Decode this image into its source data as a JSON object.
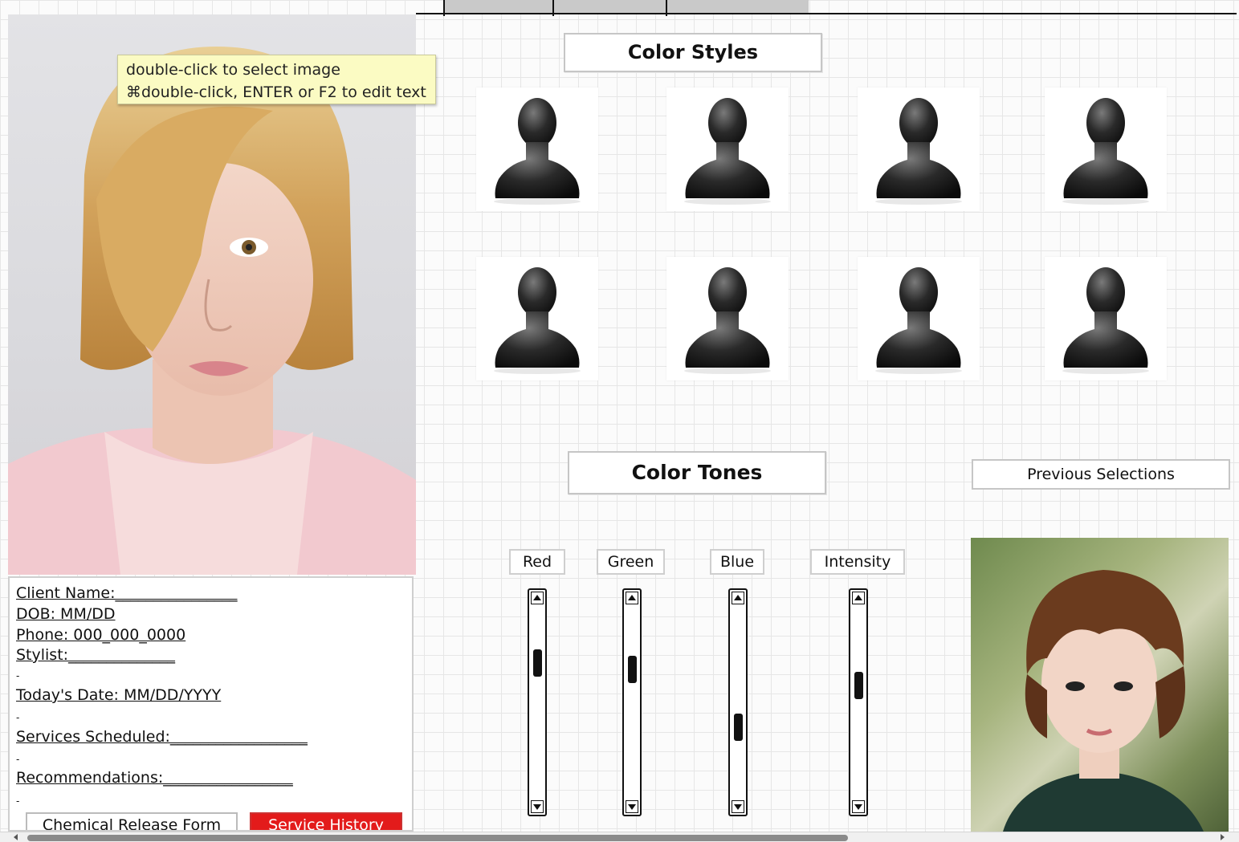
{
  "tooltip": {
    "line1": "double-click to select image",
    "line2": "⌘double-click, ENTER or F2 to edit text"
  },
  "client_form": {
    "client_name": "Client Name:________________",
    "dob": "DOB: MM/DD",
    "phone": "Phone: 000_000_0000",
    "stylist": "Stylist:______________",
    "todays_date": "Today's Date: MM/DD/YYYY",
    "services": "Services Scheduled:__________________",
    "recommendations": "Recommendations:_________________",
    "dash": "-",
    "chemical_release_label": "Chemical Release Form",
    "service_history_label": "Service History"
  },
  "color_styles": {
    "title": "Color Styles",
    "thumbnails": [
      {
        "icon": "user-silhouette-icon"
      },
      {
        "icon": "user-silhouette-icon"
      },
      {
        "icon": "user-silhouette-icon"
      },
      {
        "icon": "user-silhouette-icon"
      },
      {
        "icon": "user-silhouette-icon"
      },
      {
        "icon": "user-silhouette-icon"
      },
      {
        "icon": "user-silhouette-icon"
      },
      {
        "icon": "user-silhouette-icon"
      }
    ]
  },
  "color_tones": {
    "title": "Color Tones",
    "sliders": [
      {
        "label": "Red",
        "level": 0.26
      },
      {
        "label": "Green",
        "level": 0.3
      },
      {
        "label": "Blue",
        "level": 0.65
      },
      {
        "label": "Intensity",
        "level": 0.4
      }
    ]
  },
  "previous_selections": {
    "label": "Previous Selections"
  },
  "colors": {
    "service_history_bg": "#e31b1b",
    "tooltip_bg": "#fbfbc3",
    "grid_line": "#e6e6e6"
  }
}
